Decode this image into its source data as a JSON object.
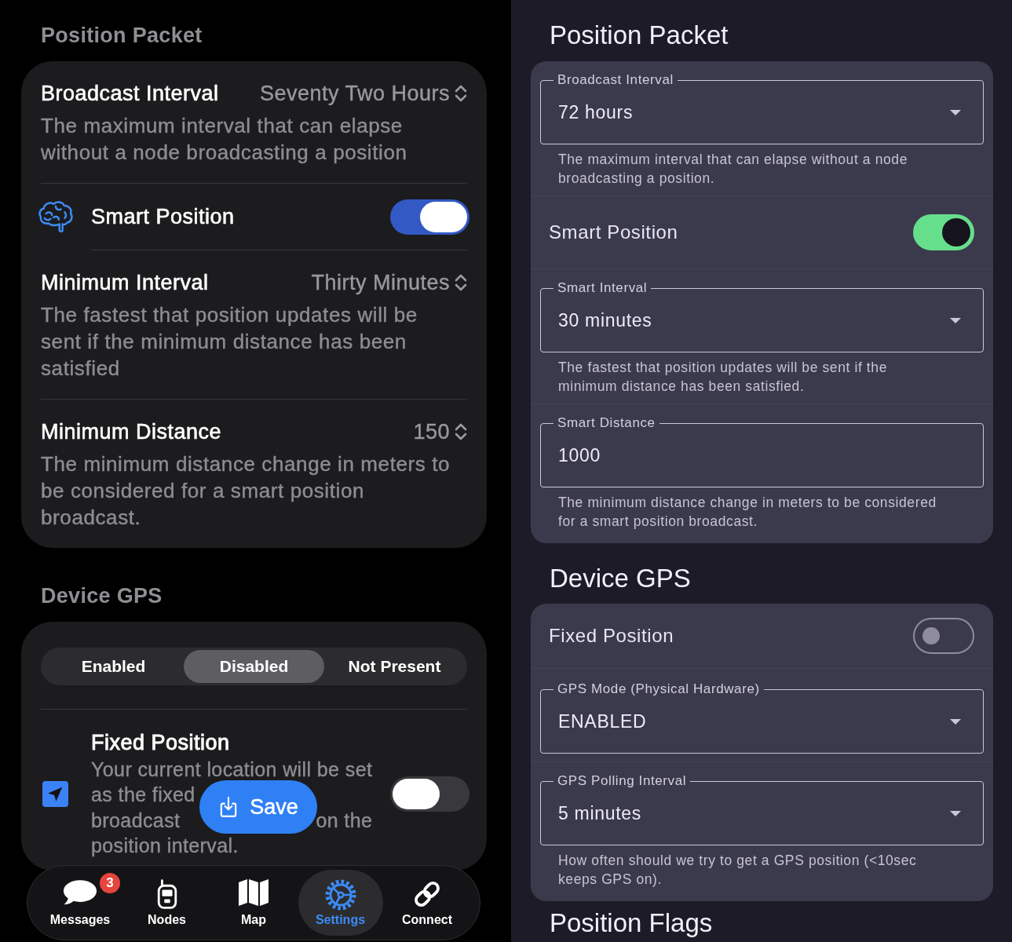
{
  "ios_settings": {
    "sections": [
      {
        "title": "Position Packet",
        "rows": [
          {
            "kind": "picker",
            "label": "Broadcast Interval",
            "value": "Seventy Two Hours",
            "description": "The maximum interval that can elapse without a node broadcasting a position"
          },
          {
            "kind": "toggle",
            "label": "Smart Position",
            "on": true
          },
          {
            "kind": "picker",
            "label": "Minimum Interval",
            "value": "Thirty Minutes",
            "description": "The fastest that position updates will be sent if the minimum distance has been satisfied"
          },
          {
            "kind": "picker",
            "label": "Minimum Distance",
            "value": "150",
            "description": "The minimum distance change in meters to be considered for a smart position broadcast."
          }
        ]
      },
      {
        "title": "Device GPS",
        "rows": [
          {
            "kind": "segmented",
            "segments": [
              {
                "label": "Enabled",
                "selected": false
              },
              {
                "label": "Disabled",
                "selected": true
              },
              {
                "label": "Not Present",
                "selected": false
              }
            ]
          },
          {
            "kind": "toggle_detail",
            "label": "Fixed Position",
            "on": false,
            "description_lines": [
              [
                "Your current location will be set"
              ],
              [
                "as the fixed"
              ],
              [
                "broadcast",
                "on the"
              ],
              [
                "position interval."
              ]
            ]
          }
        ]
      }
    ],
    "save_button": {
      "label": "Save"
    },
    "tab_bar": [
      {
        "label": "Messages",
        "badge": "3",
        "selected": false
      },
      {
        "label": "Nodes",
        "selected": false
      },
      {
        "label": "Map",
        "selected": false
      },
      {
        "label": "Settings",
        "selected": true
      },
      {
        "label": "Connect",
        "selected": false
      }
    ]
  },
  "android_settings": {
    "sections": [
      {
        "title": "Position Packet",
        "items": [
          {
            "kind": "select",
            "label": "Broadcast Interval",
            "value": "72 hours",
            "helper": "The maximum interval that can elapse without a node broadcasting a position."
          },
          {
            "kind": "toggle",
            "label": "Smart Position",
            "on": true
          },
          {
            "kind": "select",
            "label": "Smart Interval",
            "value": "30 minutes",
            "helper": "The fastest that position updates will be sent if the minimum distance has been satisfied."
          },
          {
            "kind": "text",
            "label": "Smart Distance",
            "value": "1000",
            "helper": "The minimum distance change in meters to be considered for a smart position broadcast."
          }
        ]
      },
      {
        "title": "Device GPS",
        "items": [
          {
            "kind": "toggle",
            "label": "Fixed Position",
            "on": false
          },
          {
            "kind": "select",
            "label": "GPS Mode (Physical Hardware)",
            "value": "ENABLED"
          },
          {
            "kind": "select",
            "label": "GPS Polling Interval",
            "value": "5 minutes",
            "helper": "How often should we try to get a GPS position (<10sec keeps GPS on)."
          }
        ]
      },
      {
        "title": "Position Flags"
      }
    ]
  }
}
